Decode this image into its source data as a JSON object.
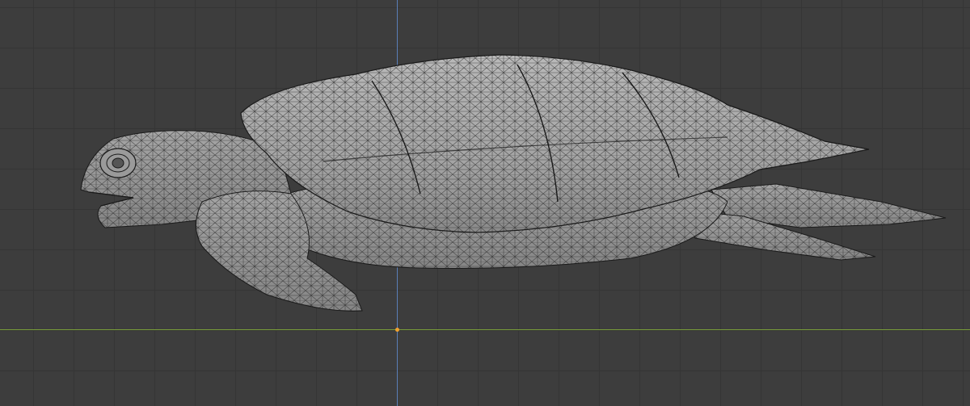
{
  "viewport": {
    "background_color": "#3d3d3d",
    "grid_color": "#353535",
    "x_axis_color": "#7aa03a",
    "y_axis_color": "#5a7fb8",
    "origin_color": "#f0a030"
  },
  "object": {
    "name_semantic": "sea-turtle-mesh",
    "shading": "solid-with-wireframe",
    "fill_color": "#a8a8a8",
    "wire_color": "#2a2a2a"
  }
}
